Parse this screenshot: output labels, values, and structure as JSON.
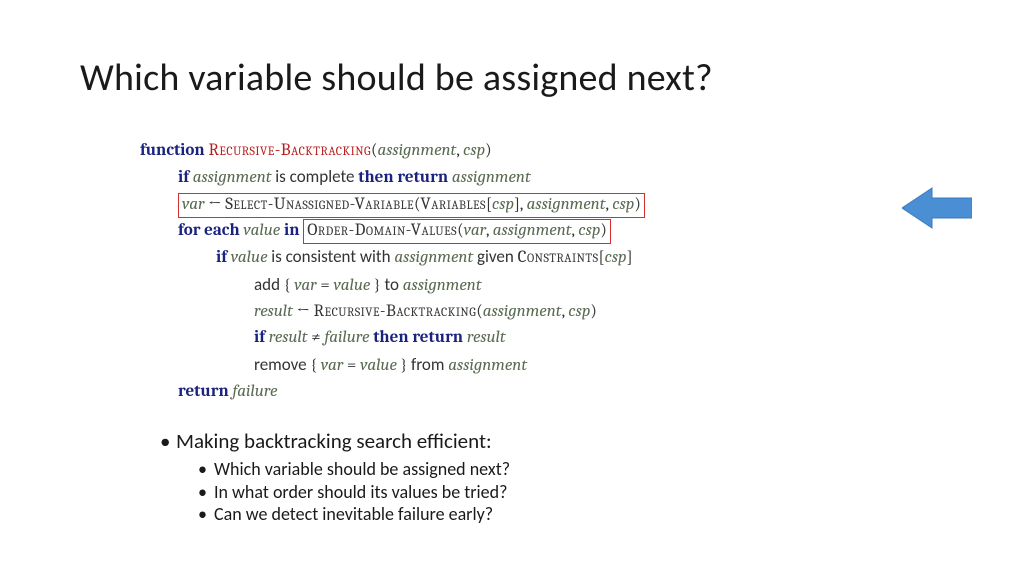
{
  "title": "Which variable should be assigned next?",
  "algo": {
    "l1": {
      "kw": "function",
      "fn": "Recursive-Backtracking",
      "args_a": "assignment",
      "args_b": "csp"
    },
    "l2": {
      "kw_if": "if",
      "var": "assignment",
      "txt": " is complete ",
      "kw_then": "then return",
      "ret": "assignment"
    },
    "l3": {
      "var": "var",
      "arrow": " ← ",
      "fn": "Select-Unassigned-Variable",
      "sub": "Variables",
      "a1": "csp",
      "a2": "assignment",
      "a3": "csp"
    },
    "l4": {
      "kw": "for each",
      "v": "value",
      "kw_in": "in",
      "fn": "Order-Domain-Values",
      "a1": "var",
      "a2": "assignment",
      "a3": "csp"
    },
    "l5": {
      "kw": "if",
      "v": "value",
      "txt1": " is consistent with ",
      "a": "assignment",
      "txt2": " given ",
      "c": "Constraints",
      "csp": "csp"
    },
    "l6": {
      "txt1": "add ",
      "lb": "{ ",
      "v1": "var",
      "eq": " = ",
      "v2": "value",
      "rb": " }",
      "txt2": " to ",
      "a": "assignment"
    },
    "l7": {
      "v": "result",
      "arrow": " ← ",
      "fn": "Recursive-Backtracking",
      "a1": "assignment",
      "a2": "csp"
    },
    "l8": {
      "kw_if": "if",
      "v": "result",
      "ne": " ≠ ",
      "f": "failure",
      "kw_then": "then return",
      "ret": "result"
    },
    "l9": {
      "txt1": "remove ",
      "lb": "{ ",
      "v1": "var",
      "eq": " = ",
      "v2": "value",
      "rb": " }",
      "txt2": " from ",
      "a": "assignment"
    },
    "l10": {
      "kw": "return",
      "v": "failure"
    }
  },
  "bullets": {
    "b1": "Making backtracking search efficient:",
    "b2a": "Which variable should be assigned next?",
    "b2b": "In what order should its values be tried?",
    "b2c": "Can we detect inevitable failure early?"
  }
}
